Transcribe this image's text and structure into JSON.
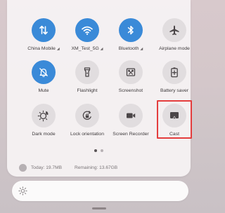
{
  "tiles": [
    {
      "label": "China Mobile",
      "icon": "data-arrows-icon",
      "active": true
    },
    {
      "label": "XM_Test_5G",
      "icon": "wifi-icon",
      "active": true
    },
    {
      "label": "Bluetooth",
      "icon": "bluetooth-icon",
      "active": true
    },
    {
      "label": "Airplane mode",
      "icon": "airplane-icon",
      "active": false
    },
    {
      "label": "Mute",
      "icon": "bell-off-icon",
      "active": true
    },
    {
      "label": "Flashlight",
      "icon": "flashlight-icon",
      "active": false
    },
    {
      "label": "Screenshot",
      "icon": "screenshot-icon",
      "active": false
    },
    {
      "label": "Battery saver",
      "icon": "battery-plus-icon",
      "active": false
    },
    {
      "label": "Dark mode",
      "icon": "dark-mode-icon",
      "active": false
    },
    {
      "label": "Lock orientation",
      "icon": "lock-rotation-icon",
      "active": false
    },
    {
      "label": "Screen Recorder",
      "icon": "video-camera-icon",
      "active": false
    },
    {
      "label": "Cast",
      "icon": "cast-icon",
      "active": false
    }
  ],
  "signal_suffix": "◢",
  "data_usage": {
    "today": "Today: 19.7MB",
    "remaining": "Remaining: 13.67GB"
  },
  "pager": {
    "pages": 2,
    "current": 1
  },
  "colors": {
    "active": "#3a8ad8",
    "inactive": "#e1dddf",
    "highlight": "#e43d3d"
  },
  "brightness_icon": "sun-icon"
}
